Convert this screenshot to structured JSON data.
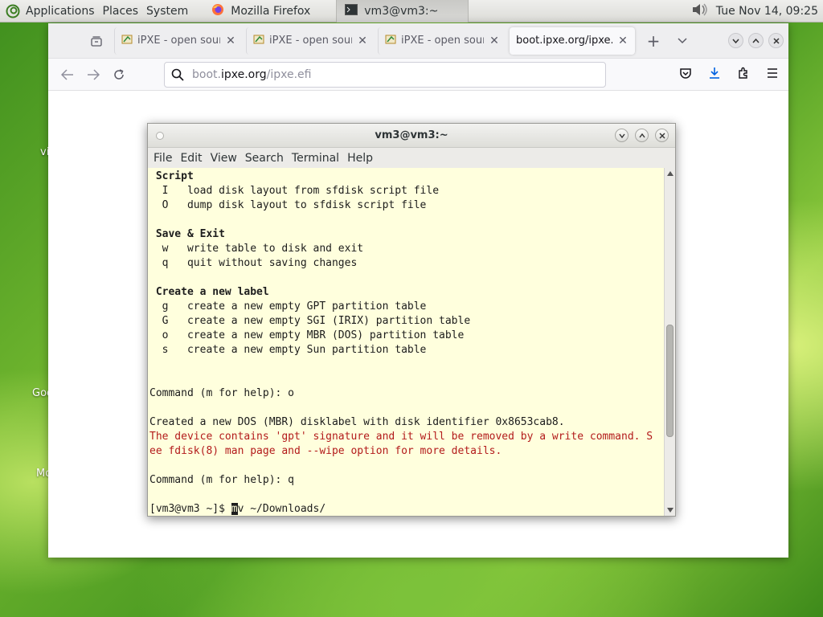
{
  "panel": {
    "menus": [
      "Applications",
      "Places",
      "System"
    ],
    "tasks": [
      {
        "label": "Mozilla Firefox",
        "icon": "firefox-icon"
      },
      {
        "label": "vm3@vm3:~",
        "icon": "terminal-icon"
      }
    ],
    "clock": "Tue Nov 14, 09:25"
  },
  "desktop_labels": [
    "vi",
    "Goo",
    "Mo"
  ],
  "firefox": {
    "tabs": [
      {
        "title": "iPXE - open source"
      },
      {
        "title": "iPXE - open source"
      },
      {
        "title": "iPXE - open source"
      },
      {
        "title": "boot.ipxe.org/ipxe.efi"
      }
    ],
    "url": {
      "prefix": "boot.",
      "host": "ipxe.org",
      "path": "/ipxe.efi"
    }
  },
  "terminal": {
    "title": "vm3@vm3:~",
    "menus": [
      "File",
      "Edit",
      "View",
      "Search",
      "Terminal",
      "Help"
    ],
    "lines": [
      {
        "text": " Script",
        "style": "bold"
      },
      {
        "text": "  I   load disk layout from sfdisk script file",
        "style": ""
      },
      {
        "text": "  O   dump disk layout to sfdisk script file",
        "style": ""
      },
      {
        "text": "",
        "style": ""
      },
      {
        "text": " Save & Exit",
        "style": "bold"
      },
      {
        "text": "  w   write table to disk and exit",
        "style": ""
      },
      {
        "text": "  q   quit without saving changes",
        "style": ""
      },
      {
        "text": "",
        "style": ""
      },
      {
        "text": " Create a new label",
        "style": "bold"
      },
      {
        "text": "  g   create a new empty GPT partition table",
        "style": ""
      },
      {
        "text": "  G   create a new empty SGI (IRIX) partition table",
        "style": ""
      },
      {
        "text": "  o   create a new empty MBR (DOS) partition table",
        "style": ""
      },
      {
        "text": "  s   create a new empty Sun partition table",
        "style": ""
      },
      {
        "text": "",
        "style": ""
      },
      {
        "text": "",
        "style": ""
      },
      {
        "text": "Command (m for help): o",
        "style": ""
      },
      {
        "text": "",
        "style": ""
      },
      {
        "text": "Created a new DOS (MBR) disklabel with disk identifier 0x8653cab8.",
        "style": ""
      },
      {
        "text": "The device contains 'gpt' signature and it will be removed by a write command. S",
        "style": "warn"
      },
      {
        "text": "ee fdisk(8) man page and --wipe option for more details.",
        "style": "warn"
      },
      {
        "text": "",
        "style": ""
      },
      {
        "text": "Command (m for help): q",
        "style": ""
      },
      {
        "text": "",
        "style": ""
      }
    ],
    "prompt": {
      "before": "[vm3@vm3 ~]$ ",
      "cursor_char": "m",
      "after": "v ~/Downloads/"
    },
    "scroll_position": 0.72
  }
}
